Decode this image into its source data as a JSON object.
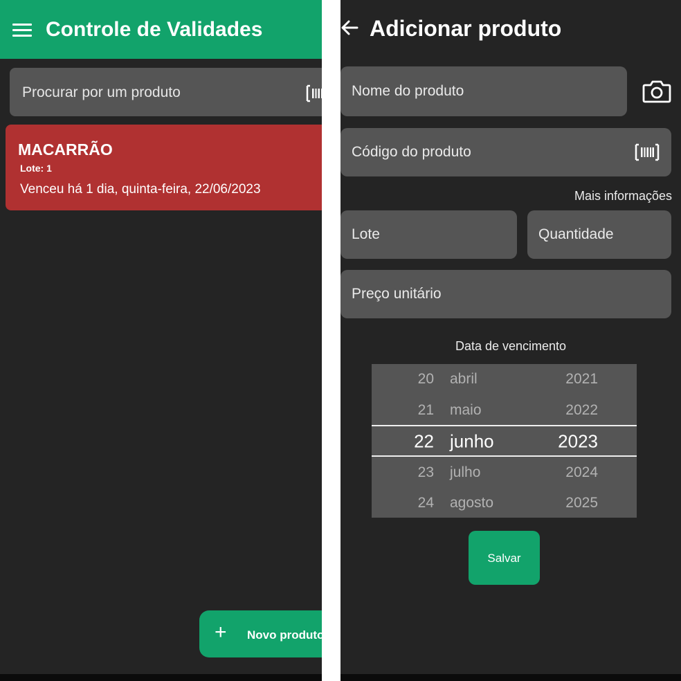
{
  "left_screen": {
    "app_bar": {
      "title": "Controle de Validades",
      "menu_icon": "hamburger-menu-icon",
      "background_color": "#12a36b"
    },
    "search": {
      "placeholder": "Procurar por um produto",
      "icon": "barcode-icon"
    },
    "products": [
      {
        "name": "MACARRÃO",
        "lote": "Lote: 1",
        "status": "Venceu há 1 dia, quinta-feira, 22/06/2023",
        "card_color": "#b03131"
      }
    ],
    "fab": {
      "icon": "plus-icon",
      "label": "Novo produto"
    }
  },
  "right_screen": {
    "header": {
      "back_icon": "arrow-left-icon",
      "title": "Adicionar produto"
    },
    "form": {
      "product_name_placeholder": "Nome do produto",
      "camera_icon": "camera-icon",
      "product_code_placeholder": "Código do produto",
      "code_icon": "barcode-icon",
      "more_info_label": "Mais informações",
      "lote_placeholder": "Lote",
      "quantity_placeholder": "Quantidade",
      "unit_price_placeholder": "Preço unitário"
    },
    "date_picker": {
      "label": "Data de vencimento",
      "rows": [
        {
          "day": "20",
          "month": "abril",
          "year": "2021"
        },
        {
          "day": "21",
          "month": "maio",
          "year": "2022"
        },
        {
          "day": "22",
          "month": "junho",
          "year": "2023"
        },
        {
          "day": "23",
          "month": "julho",
          "year": "2024"
        },
        {
          "day": "24",
          "month": "agosto",
          "year": "2025"
        }
      ],
      "selected": {
        "day": "22",
        "month": "junho",
        "year": "2023"
      }
    },
    "save_button": {
      "label": "Salvar"
    }
  },
  "colors": {
    "accent": "#12a36b",
    "background": "#242424",
    "field": "#555555",
    "expired_card": "#b03131"
  }
}
